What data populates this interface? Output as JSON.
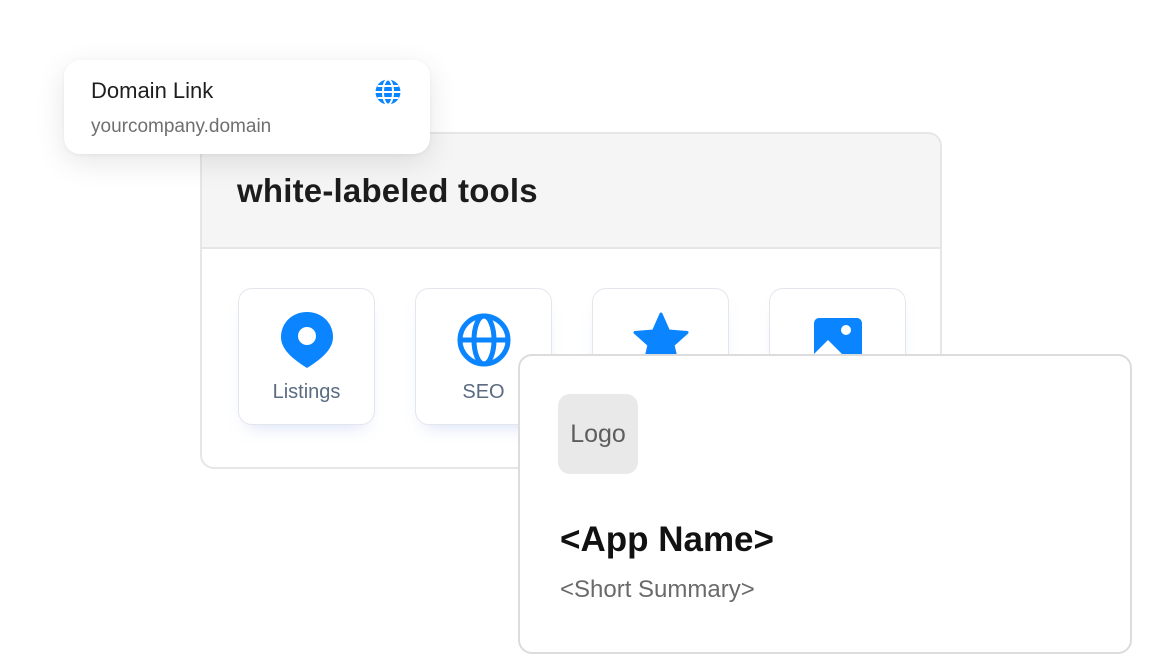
{
  "domain_card": {
    "title": "Domain Link",
    "url": "yourcompany.domain",
    "icon": "globe-icon"
  },
  "tools_panel": {
    "title": "white-labeled tools",
    "tiles": [
      {
        "label": "Listings",
        "icon": "map-pin-icon"
      },
      {
        "label": "SEO",
        "icon": "globe-icon"
      },
      {
        "label": "",
        "icon": "star-icon"
      },
      {
        "label": "",
        "icon": "image-icon"
      }
    ]
  },
  "app_card": {
    "logo_text": "Logo",
    "app_name": "<App Name>",
    "summary": "<Short Summary>"
  },
  "colors": {
    "accent": "#0a84ff",
    "label": "#5a6b82"
  }
}
